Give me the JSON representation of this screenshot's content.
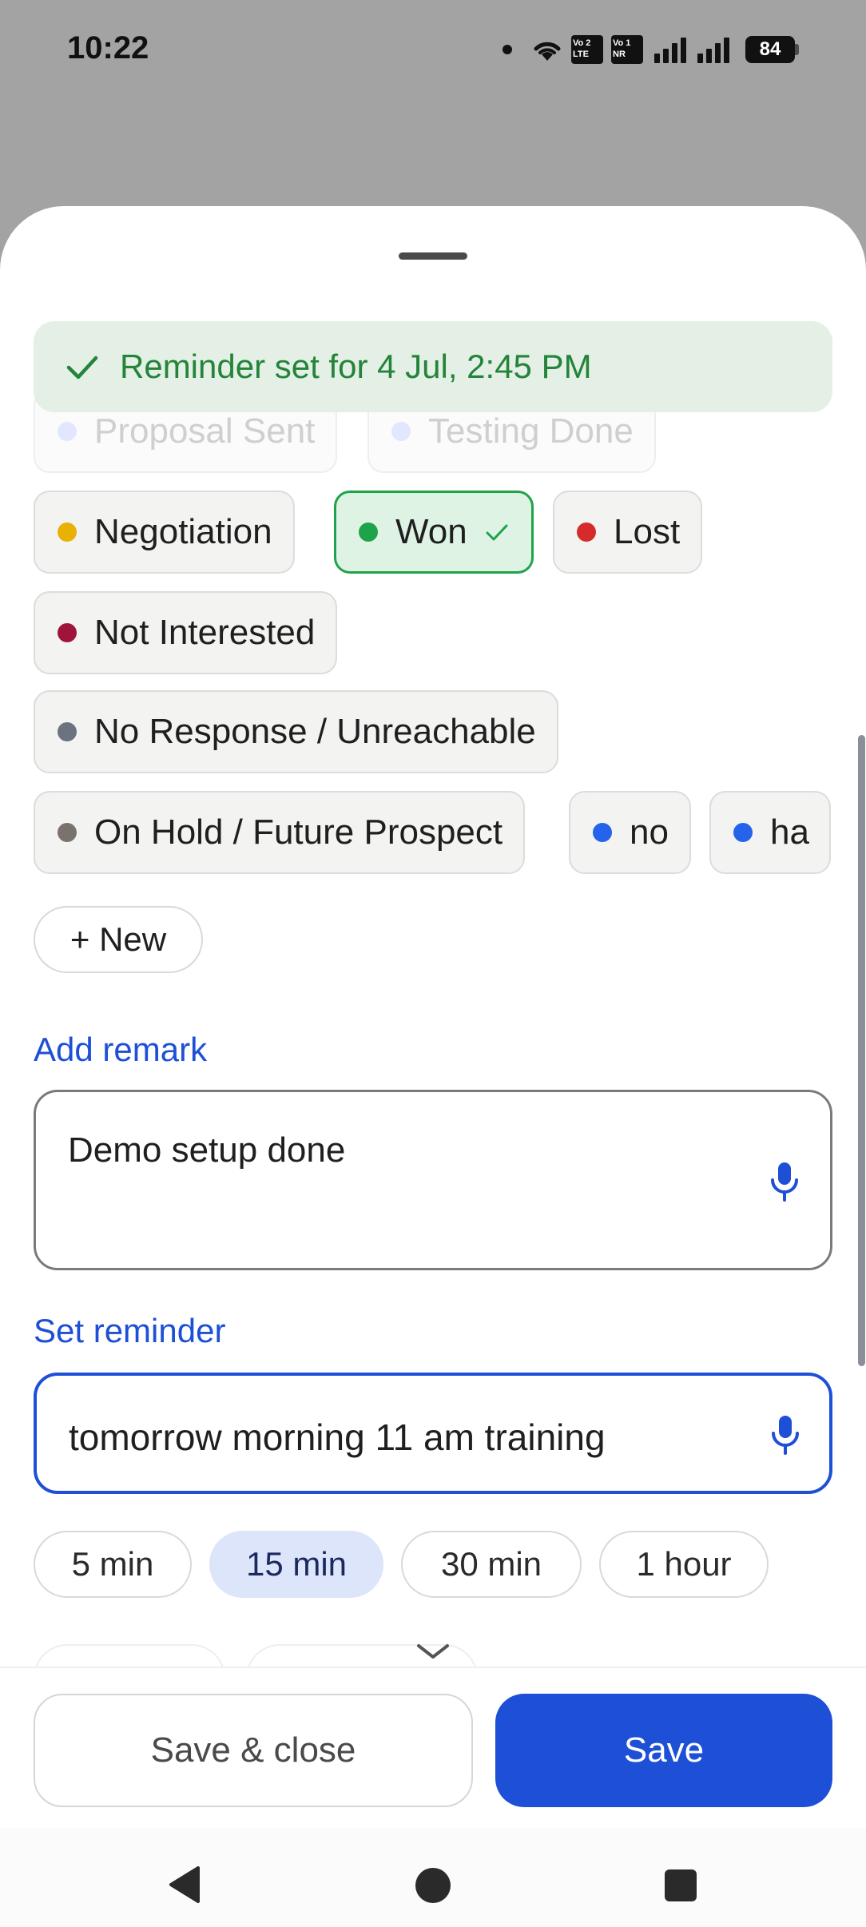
{
  "status_bar": {
    "time": "10:22",
    "battery": "84",
    "sim1_line1": "Vo 2",
    "sim1_line2": "LTE",
    "sim2_line1": "Vo 1",
    "sim2_line2": "NR"
  },
  "toast": {
    "text": "Reminder set for 4 Jul, 2:45 PM",
    "color": "#23843a"
  },
  "stages": {
    "faded_1": "Proposal Sent",
    "faded_2": "Testing Done",
    "negotiation": "Negotiation",
    "won": "Won",
    "lost": "Lost",
    "not_interested": "Not Interested",
    "no_response": "No Response / Unreachable",
    "on_hold": "On Hold / Future Prospect",
    "no": "no",
    "ha": "ha",
    "new_button": "+ New",
    "selected": "Won",
    "colors": {
      "negotiation": "#e8b106",
      "won": "#1ea34a",
      "lost": "#d52b2b",
      "not_interested": "#a0143c",
      "no_response": "#6b7280",
      "on_hold": "#7a736d",
      "custom": "#2563eb"
    }
  },
  "remark": {
    "label": "Add remark",
    "value": "Demo setup done"
  },
  "reminder": {
    "label": "Set reminder",
    "value": "tomorrow morning 11 am training",
    "quick_options": [
      "5 min",
      "15 min",
      "30 min",
      "1 hour"
    ],
    "selected_option": "15 min"
  },
  "footer": {
    "save_close_label": "Save & close",
    "save_label": "Save"
  },
  "accent_color": "#1d4fd7"
}
